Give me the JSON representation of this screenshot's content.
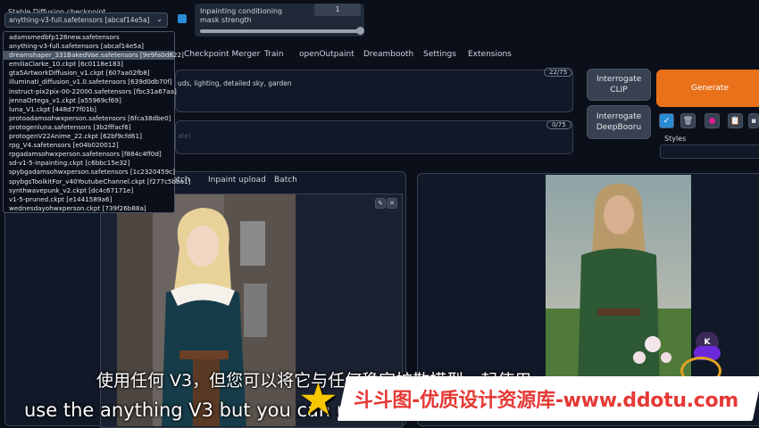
{
  "checkpoint": {
    "label": "Stable Diffusion checkpoint",
    "selected": "anything-v3-full.safetensors [abcaf14e5a]",
    "options": [
      "adamsmedbfp128new.safetensors",
      "anything-v3-full.safetensors [abcaf14e5a]",
      "dreamshaper_331BakedVae.safetensors [9e9fa0d822]",
      "emiliaClarke_10.ckpt [6c0118e183]",
      "gta5ArtworkDiffusion_v1.ckpt [607aa02fb8]",
      "illuminati_diffusion_v1.0.safetensors [639d0db70f]",
      "instruct-pix2pix-00-22000.safetensors [fbc31a67aa]",
      "jennaOrtega_v1.ckpt [a55969cf69]",
      "luna_V1.ckpt [448d77f01b]",
      "protoadamsohwxperson.safetensors [6fca38dbe0]",
      "protogenluna.safetensors [3b2fffacf6]",
      "protogenV22Anime_22.ckpt [62bf9cfd61]",
      "rpg_V4.safetensors [e04b020012]",
      "rpgadamsohwxperson.safetensors [f884c4ff0d]",
      "sd-v1-5-inpainting.ckpt [c6bbc15e32]",
      "spybgadamsohwxperson.safetensors [1c2320459c]",
      "spybgsToolkitFor_v40YoutubeChannel.ckpt [f277c5bba1]",
      "synthwavepunk_v2.ckpt [dc4c67171e]",
      "v1-5-pruned.ckpt [e1441589a6]",
      "wednesdayohwxperson.ckpt [739f26b88a]"
    ],
    "selected_index": 2
  },
  "mask_strength": {
    "label": "Inpainting conditioning mask strength",
    "value": "1",
    "fraction": 1.0
  },
  "top_tabs": [
    "Checkpoint Merger",
    "Train",
    "openOutpaint",
    "Dreambooth",
    "Settings",
    "Extensions"
  ],
  "prompt": {
    "text": "uds, lighting, detailed sky, garden",
    "counter": "22/75"
  },
  "negative": {
    "placeholder": "ate)",
    "counter": "0/75"
  },
  "buttons": {
    "interrogate_clip": "Interrogate CLIP",
    "interrogate_deepbooru": "Interrogate DeepBooru",
    "generate": "Generate"
  },
  "styles_label": "Styles",
  "sub_tabs": [
    "etch",
    "Inpaint upload",
    "Batch"
  ],
  "subtitles": {
    "cn": "使用任何 V3，但您可以将它与任何稳定扩散模型一起使用",
    "en": "use the anything V3 but you can use"
  },
  "watermark": "斗斗图-优质设计资源库-www.ddotu.com",
  "badge_letter": "K",
  "colors": {
    "generate": "#e8711a",
    "accent": "#2563eb",
    "watermark_bg": "#ffffff",
    "watermark_text": "#e53935"
  }
}
